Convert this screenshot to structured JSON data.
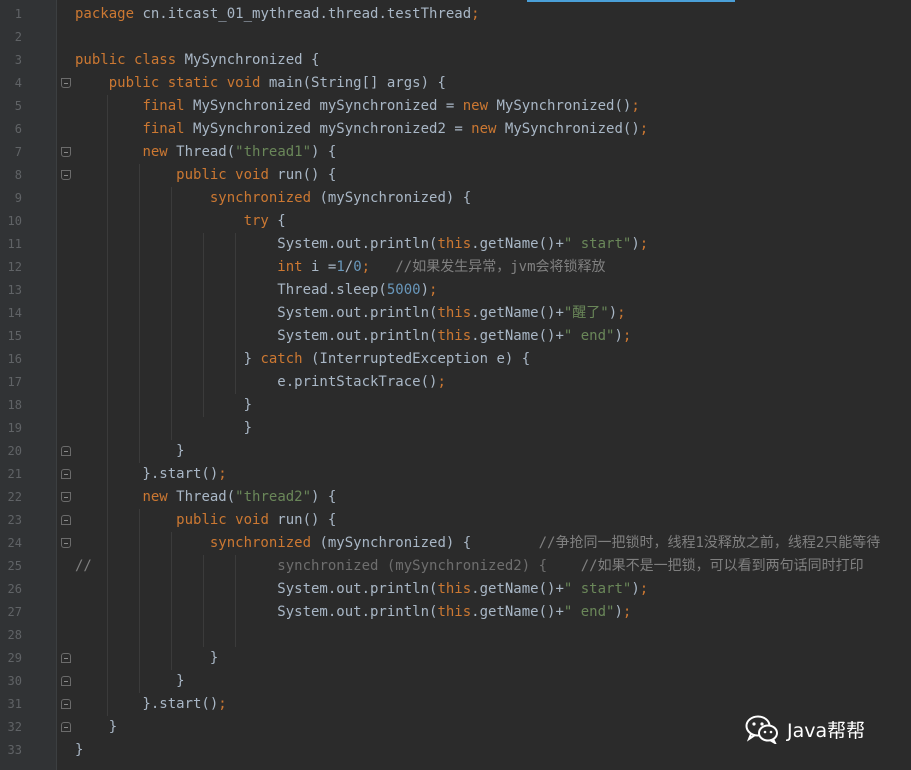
{
  "editor": {
    "lines": [
      {
        "n": "1",
        "code": [
          [
            "kw",
            "package"
          ],
          [
            "p",
            " cn.itcast_01_mythread.thread.testThread"
          ],
          [
            "kw",
            ";"
          ]
        ]
      },
      {
        "n": "2",
        "code": []
      },
      {
        "n": "3",
        "code": [
          [
            "kw",
            "public class"
          ],
          [
            "p",
            " MySynchronized {"
          ]
        ]
      },
      {
        "n": "4",
        "code": [
          [
            "p",
            "    "
          ],
          [
            "kw",
            "public static void"
          ],
          [
            "p",
            " main(String[] args) {"
          ]
        ]
      },
      {
        "n": "5",
        "code": [
          [
            "p",
            "        "
          ],
          [
            "kw",
            "final"
          ],
          [
            "p",
            " MySynchronized mySynchronized = "
          ],
          [
            "kw",
            "new"
          ],
          [
            "p",
            " MySynchronized()"
          ],
          [
            "kw",
            ";"
          ]
        ]
      },
      {
        "n": "6",
        "code": [
          [
            "p",
            "        "
          ],
          [
            "kw",
            "final"
          ],
          [
            "p",
            " MySynchronized mySynchronized2 = "
          ],
          [
            "kw",
            "new"
          ],
          [
            "p",
            " MySynchronized()"
          ],
          [
            "kw",
            ";"
          ]
        ]
      },
      {
        "n": "7",
        "code": [
          [
            "p",
            "        "
          ],
          [
            "kw",
            "new"
          ],
          [
            "p",
            " Thread("
          ],
          [
            "str",
            "\"thread1\""
          ],
          [
            "p",
            ") {"
          ]
        ]
      },
      {
        "n": "8",
        "code": [
          [
            "p",
            "            "
          ],
          [
            "kw",
            "public void"
          ],
          [
            "p",
            " run() {"
          ]
        ]
      },
      {
        "n": "9",
        "code": [
          [
            "p",
            "                "
          ],
          [
            "kw",
            "synchronized"
          ],
          [
            "p",
            " (mySynchronized) {"
          ]
        ]
      },
      {
        "n": "10",
        "code": [
          [
            "p",
            "                    "
          ],
          [
            "kw",
            "try"
          ],
          [
            "p",
            " {"
          ]
        ]
      },
      {
        "n": "11",
        "code": [
          [
            "p",
            "                        System.out.println("
          ],
          [
            "kw",
            "this"
          ],
          [
            "p",
            ".getName()+"
          ],
          [
            "str",
            "\" start\""
          ],
          [
            "p",
            ")"
          ],
          [
            "kw",
            ";"
          ]
        ]
      },
      {
        "n": "12",
        "code": [
          [
            "p",
            "                        "
          ],
          [
            "kw",
            "int"
          ],
          [
            "p",
            " i ="
          ],
          [
            "num",
            "1"
          ],
          [
            "p",
            "/"
          ],
          [
            "num",
            "0"
          ],
          [
            "kw",
            ";"
          ],
          [
            "p",
            "   "
          ],
          [
            "cmt",
            "//如果发生异常，jvm会将锁释放"
          ]
        ]
      },
      {
        "n": "13",
        "code": [
          [
            "p",
            "                        Thread.sleep("
          ],
          [
            "num",
            "5000"
          ],
          [
            "p",
            ")"
          ],
          [
            "kw",
            ";"
          ]
        ]
      },
      {
        "n": "14",
        "code": [
          [
            "p",
            "                        System.out.println("
          ],
          [
            "kw",
            "this"
          ],
          [
            "p",
            ".getName()+"
          ],
          [
            "str",
            "\"醒了\""
          ],
          [
            "p",
            ")"
          ],
          [
            "kw",
            ";"
          ]
        ]
      },
      {
        "n": "15",
        "code": [
          [
            "p",
            "                        System.out.println("
          ],
          [
            "kw",
            "this"
          ],
          [
            "p",
            ".getName()+"
          ],
          [
            "str",
            "\" end\""
          ],
          [
            "p",
            ")"
          ],
          [
            "kw",
            ";"
          ]
        ]
      },
      {
        "n": "16",
        "code": [
          [
            "p",
            "                    } "
          ],
          [
            "kw",
            "catch"
          ],
          [
            "p",
            " (InterruptedException e) {"
          ]
        ]
      },
      {
        "n": "17",
        "code": [
          [
            "p",
            "                        e.printStackTrace()"
          ],
          [
            "kw",
            ";"
          ]
        ]
      },
      {
        "n": "18",
        "code": [
          [
            "p",
            "                    }"
          ]
        ]
      },
      {
        "n": "19",
        "code": [
          [
            "p",
            "                    }"
          ]
        ]
      },
      {
        "n": "20",
        "code": [
          [
            "p",
            "            }"
          ]
        ]
      },
      {
        "n": "21",
        "code": [
          [
            "p",
            "        }.start()"
          ],
          [
            "kw",
            ";"
          ]
        ]
      },
      {
        "n": "22",
        "code": [
          [
            "p",
            "        "
          ],
          [
            "kw",
            "new"
          ],
          [
            "p",
            " Thread("
          ],
          [
            "str",
            "\"thread2\""
          ],
          [
            "p",
            ") {"
          ]
        ]
      },
      {
        "n": "23",
        "code": [
          [
            "p",
            "            "
          ],
          [
            "kw",
            "public void"
          ],
          [
            "p",
            " run() {"
          ]
        ]
      },
      {
        "n": "24",
        "code": [
          [
            "p",
            "                "
          ],
          [
            "kw",
            "synchronized"
          ],
          [
            "p",
            " (mySynchronized) {        "
          ],
          [
            "cmt",
            "//争抢同一把锁时，线程1没释放之前，线程2只能等待"
          ]
        ]
      },
      {
        "n": "25",
        "code": [
          [
            "cmt",
            "//"
          ],
          [
            "p",
            "                      "
          ],
          [
            "dim",
            "synchronized (mySynchronized2) {"
          ],
          [
            "p",
            "    "
          ],
          [
            "cmt",
            "//如果不是一把锁，可以看到两句话同时打印"
          ]
        ]
      },
      {
        "n": "26",
        "code": [
          [
            "p",
            "                        System.out.println("
          ],
          [
            "kw",
            "this"
          ],
          [
            "p",
            ".getName()+"
          ],
          [
            "str",
            "\" start\""
          ],
          [
            "p",
            ")"
          ],
          [
            "kw",
            ";"
          ]
        ]
      },
      {
        "n": "27",
        "code": [
          [
            "p",
            "                        System.out.println("
          ],
          [
            "kw",
            "this"
          ],
          [
            "p",
            ".getName()+"
          ],
          [
            "str",
            "\" end\""
          ],
          [
            "p",
            ")"
          ],
          [
            "kw",
            ";"
          ]
        ]
      },
      {
        "n": "28",
        "code": []
      },
      {
        "n": "29",
        "code": [
          [
            "p",
            "                }"
          ]
        ]
      },
      {
        "n": "30",
        "code": [
          [
            "p",
            "            }"
          ]
        ]
      },
      {
        "n": "31",
        "code": [
          [
            "p",
            "        }.start()"
          ],
          [
            "kw",
            ";"
          ]
        ]
      },
      {
        "n": "32",
        "code": [
          [
            "p",
            "    }"
          ]
        ]
      },
      {
        "n": "33",
        "code": [
          [
            "p",
            "}"
          ]
        ]
      }
    ]
  },
  "watermark": {
    "icon": "wechat-icon",
    "text": "Java帮帮"
  },
  "colors": {
    "background": "#2b2b2b",
    "keyword": "#cc7832",
    "string": "#6a8759",
    "number": "#6897bb",
    "comment": "#808080",
    "plain": "#a9b7c6"
  }
}
